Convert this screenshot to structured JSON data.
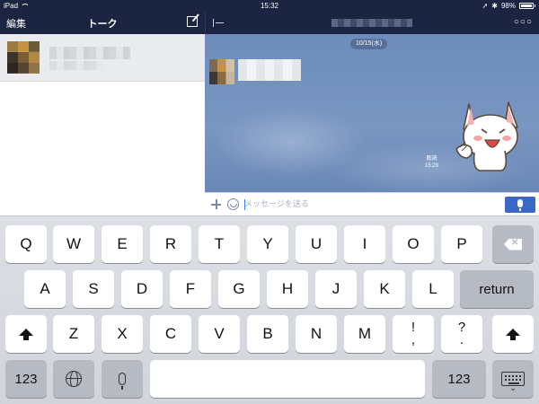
{
  "status_bar": {
    "device": "iPad",
    "time": "15:32",
    "battery": "98%"
  },
  "left_pane": {
    "edit_label": "編集",
    "title": "トーク"
  },
  "chat": {
    "date": "10/15(水)",
    "read_label": "既読",
    "message_time": "15:29",
    "input_placeholder": "メッセージを送る"
  },
  "keyboard": {
    "row1": [
      "Q",
      "W",
      "E",
      "R",
      "T",
      "Y",
      "U",
      "I",
      "O",
      "P"
    ],
    "row2": [
      "A",
      "S",
      "D",
      "F",
      "G",
      "H",
      "J",
      "K",
      "L"
    ],
    "return_label": "return",
    "row3": [
      "Z",
      "X",
      "C",
      "V",
      "B",
      "N",
      "M"
    ],
    "punct1": [
      "!",
      ","
    ],
    "punct2": [
      "?",
      "."
    ],
    "numbers_label": "123"
  },
  "colors": {
    "nav": "#1b2440",
    "chat_bg": "#7393c0",
    "accent": "#3b67c6"
  }
}
